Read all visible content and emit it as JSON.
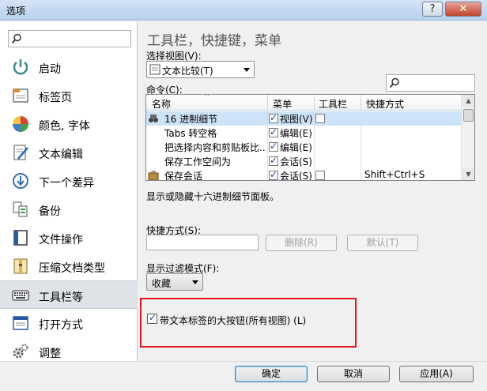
{
  "window": {
    "title": "选项",
    "help_label": "?",
    "close_label": "✕"
  },
  "sidebar": {
    "items": [
      {
        "label": "启动",
        "icon": "power-icon"
      },
      {
        "label": "标签页",
        "icon": "tab-page-icon"
      },
      {
        "label": "颜色, 字体",
        "icon": "palette-icon"
      },
      {
        "label": "文本编辑",
        "icon": "text-edit-icon"
      },
      {
        "label": "下一个差异",
        "icon": "next-diff-icon"
      },
      {
        "label": "备份",
        "icon": "backup-icon"
      },
      {
        "label": "文件操作",
        "icon": "file-ops-icon"
      },
      {
        "label": "压缩文档类型",
        "icon": "archive-icon"
      },
      {
        "label": "工具栏等",
        "icon": "keyboard-icon"
      },
      {
        "label": "打开方式",
        "icon": "open-with-icon"
      },
      {
        "label": "调整",
        "icon": "gears-icon"
      }
    ],
    "active_index": 8
  },
  "main": {
    "heading": "工具栏，快捷键，菜单",
    "view_label": "选择视图(V):",
    "view_value": "文本比较(T)",
    "commands_label": "命令(C):",
    "columns": [
      "名称",
      "菜单",
      "工具栏",
      "快捷方式"
    ],
    "rows": [
      {
        "name": "16 进制细节",
        "menu": "视图(V)",
        "menu_on": true,
        "toolbar_on": false,
        "shortcut": "",
        "selected": true
      },
      {
        "name": "Tabs 转空格",
        "menu": "编辑(E)",
        "menu_on": true,
        "toolbar_on": false,
        "shortcut": "",
        "selected": false
      },
      {
        "name": "把选择内容和剪贴板比...",
        "menu": "编辑(E)",
        "menu_on": true,
        "toolbar_on": false,
        "shortcut": "",
        "selected": false
      },
      {
        "name": "保存工作空间为",
        "menu": "会话(S)",
        "menu_on": true,
        "toolbar_on": false,
        "shortcut": "",
        "selected": false
      },
      {
        "name": "保存会话",
        "menu": "会话(S)",
        "menu_on": true,
        "toolbar_on": false,
        "shortcut": "Shift+Ctrl+S",
        "selected": false
      }
    ],
    "description": "显示或隐藏十六进制细节面板。",
    "shortcut_label": "快捷方式(S):",
    "shortcut_value": "",
    "delete_label": "删除(R)",
    "default_label": "默认(T)",
    "filter_label": "显示过滤模式(F):",
    "filter_value": "收藏",
    "big_buttons_label": "带文本标签的大按钮(所有视图) (L)",
    "big_buttons_checked": true
  },
  "footer": {
    "ok": "确定",
    "cancel": "取消",
    "apply": "应用(A)"
  }
}
